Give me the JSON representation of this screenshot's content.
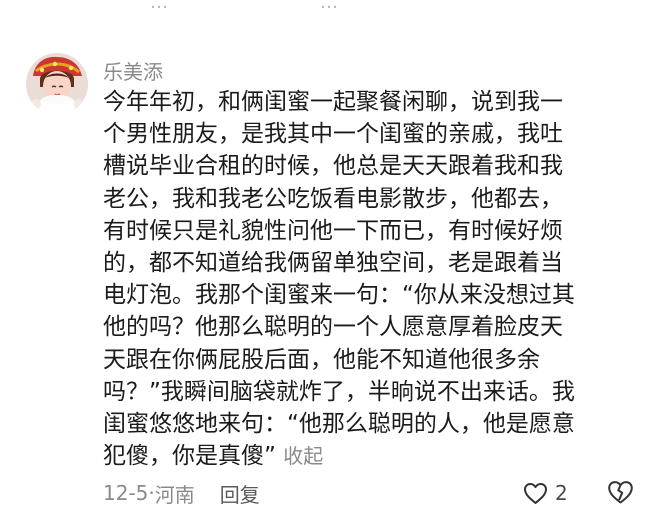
{
  "previous_comment": {
    "faded_fragments": [
      "…",
      "…"
    ]
  },
  "comment": {
    "username": "乐美添",
    "lines": [
      "今年年初，和俩闺蜜一起聚餐闲聊，说到我一",
      "个男性朋友，是我其中一个闺蜜的亲戚，我吐",
      "槽说毕业合租的时候，他总是天天跟着我和我",
      "老公，我和我老公吃饭看电影散步，他都去，",
      "有时候只是礼貌性问他一下而已，有时候好烦",
      "的，都不知道给我俩留单独空间，老是跟着当",
      "电灯泡。我那个闺蜜来一句：“你从来没想过其",
      "他的吗？他那么聪明的一个人愿意厚着脸皮天",
      "天跟在你俩屁股后面，他能不知道他很多余",
      "吗？”我瞬间脑袋就炸了，半晌说不出来话。我",
      "闺蜜悠悠地来句：“他那么聪明的人，他是愿意"
    ],
    "last_line": "犯傻，你是真傻”",
    "collapse_label": "收起",
    "date": "12-5",
    "separator": "·",
    "location": "河南",
    "reply_label": "回复",
    "like_count": "2",
    "icons": {
      "like": "heart-outline-icon",
      "dislike": "broken-heart-icon"
    },
    "colors": {
      "text": "#1b1b1b",
      "meta": "#8a8a8a",
      "reply": "#5a5a5a",
      "icon": "#333333"
    }
  }
}
